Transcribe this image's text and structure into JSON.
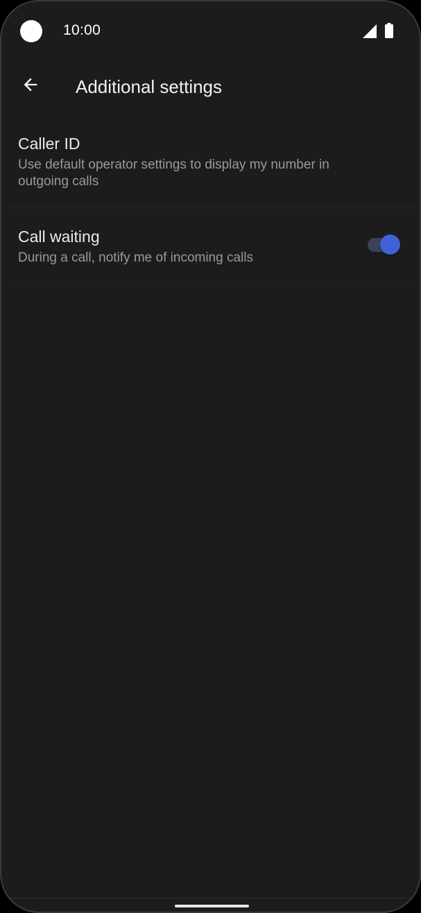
{
  "status_bar": {
    "time": "10:00",
    "icons": [
      "camera-cutout",
      "signal-icon",
      "battery-icon"
    ]
  },
  "app_bar": {
    "back_icon": "arrow-left-icon",
    "title": "Additional settings"
  },
  "settings": [
    {
      "title": "Caller ID",
      "summary": "Use default operator settings to display my number in outgoing calls"
    },
    {
      "title": "Call waiting",
      "summary": "During a call, notify me of incoming calls",
      "toggle_on": true
    }
  ],
  "colors": {
    "background": "#1c1c1c",
    "accent": "#3f63d6",
    "toggle_track": "#3b4256",
    "title_text": "#ececec",
    "summary_text": "#9a9a9a"
  }
}
